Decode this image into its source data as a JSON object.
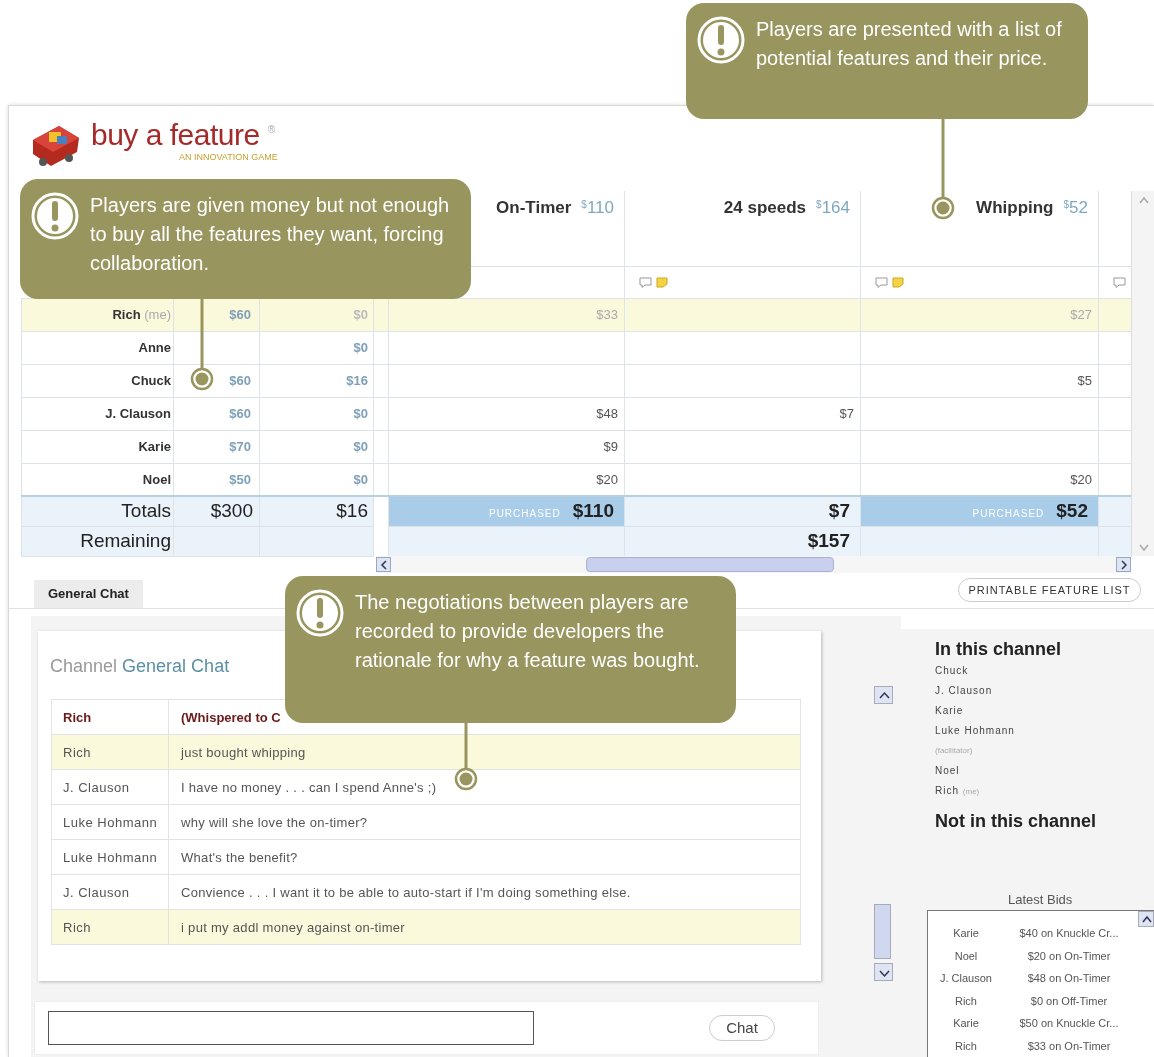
{
  "logo": {
    "name": "buy a feature",
    "registered": "®",
    "tagline": "AN INNOVATION GAME"
  },
  "features": [
    {
      "name": "On-Timer",
      "price": "$^{$}$110"
    },
    {
      "name": "24 speeds",
      "price": "$^{$}$164"
    },
    {
      "name": "Whipping",
      "price": "$^{$}$52"
    }
  ],
  "players": [
    {
      "name": "Rich",
      "me": "(me)",
      "highlighted": true,
      "budget": "$60",
      "balance": "$0",
      "bids": {
        "feature_1": "$33",
        "feature_3": "$27"
      }
    },
    {
      "name": "Anne",
      "highlighted": false,
      "balance": "$0"
    },
    {
      "name": "Chuck",
      "highlighted": false,
      "budget": "$60",
      "balance": "$16",
      "bids": {
        "feature_3": "$5"
      }
    },
    {
      "name": "J. Clauson",
      "highlighted": false,
      "budget": "$60",
      "balance": "$0",
      "bids": {
        "feature_1": "$48",
        "feature_2": "$7"
      }
    },
    {
      "name": "Karie",
      "highlighted": false,
      "budget": "$70",
      "balance": "$0",
      "bids": {
        "feature_1": "$9"
      }
    },
    {
      "name": "Noel",
      "highlighted": false,
      "budget": "$50",
      "balance": "$0",
      "bids": {
        "feature_1": "$20",
        "feature_3": "$20"
      }
    }
  ],
  "totals": {
    "label": "Totals",
    "budget": "$300",
    "balance": "$16",
    "features": [
      {
        "purchased": true,
        "badge": "PURCHASED",
        "value": "$110"
      },
      {
        "purchased": false,
        "value": "$7"
      },
      {
        "purchased": true,
        "badge": "PURCHASED",
        "value": "$52"
      }
    ]
  },
  "remaining": {
    "label": "Remaining",
    "features": {
      "feature_2": "$157"
    }
  },
  "chat_tabs": [
    {
      "label": "General Chat",
      "selected": true
    }
  ],
  "printable_button": "PRINTABLE FEATURE LIST",
  "channel": {
    "prefix": "Channel",
    "name": "General Chat"
  },
  "messages": [
    {
      "from": "Rich",
      "text": "(Whispered to C",
      "kind": "whisper",
      "highlighted": false
    },
    {
      "from": "Rich",
      "text": "just bought whipping",
      "kind": "normal",
      "highlighted": true
    },
    {
      "from": "J. Clauson",
      "text": "I have no money . . . can I spend Anne's ;)",
      "kind": "normal",
      "highlighted": false
    },
    {
      "from": "Luke Hohmann",
      "text": "why will she love the on-timer?",
      "kind": "normal",
      "highlighted": false
    },
    {
      "from": "Luke Hohmann",
      "text": "What's the benefit?",
      "kind": "normal",
      "highlighted": false
    },
    {
      "from": "J. Clauson",
      "text": "Convience . . . I want it to be able to auto-start if I'm doing something else.",
      "kind": "normal",
      "highlighted": false
    },
    {
      "from": "Rich",
      "text": "i put my addl money against on-timer",
      "kind": "normal",
      "highlighted": true
    }
  ],
  "chat_button": "Chat",
  "in_channel": {
    "title": "In this channel",
    "members": [
      {
        "name": "Chuck"
      },
      {
        "name": "J. Clauson"
      },
      {
        "name": "Karie"
      },
      {
        "name": "Luke Hohmann",
        "note": "(facilitator)"
      },
      {
        "name": "Noel"
      },
      {
        "name": "Rich",
        "note": "(me)"
      }
    ]
  },
  "not_in_channel": {
    "title": "Not in this channel"
  },
  "latest_bids": {
    "title": "Latest Bids",
    "bids": [
      {
        "player": "Karie",
        "bid": "$40 on Knuckle Cr..."
      },
      {
        "player": "Noel",
        "bid": "$20 on On-Timer"
      },
      {
        "player": "J. Clauson",
        "bid": "$48 on On-Timer"
      },
      {
        "player": "Rich",
        "bid": "$0 on Off-Timer"
      },
      {
        "player": "Karie",
        "bid": "$50 on Knuckle Cr..."
      },
      {
        "player": "Rich",
        "bid": "$33 on On-Timer"
      }
    ]
  },
  "callouts": [
    {
      "text": "Players are presented with a list of potential features and their price."
    },
    {
      "text": "Players are given money but not enough to buy all the features they want, forcing collaboration."
    },
    {
      "text": "The negotiations between players are recorded to provide developers the rationale for why a feature was bought."
    }
  ]
}
